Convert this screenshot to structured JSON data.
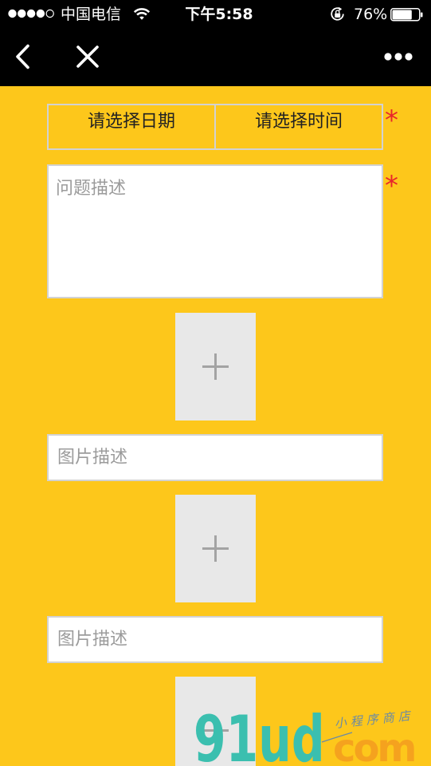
{
  "status_bar": {
    "signal": {
      "icon": "signal-dots-icon",
      "level": 4,
      "max": 5
    },
    "carrier": "中国电信",
    "wifi_icon": "wifi-icon",
    "time": "下午5:58",
    "rotation_lock_icon": "rotation-lock-icon",
    "battery": {
      "icon": "battery-icon",
      "percent_text": "76%",
      "level": 0.76
    }
  },
  "nav_bar": {
    "back_icon": "chevron-left-icon",
    "close_icon": "close-icon",
    "more_icon": "more-dots-icon"
  },
  "form": {
    "date_picker": {
      "label": "请选择日期"
    },
    "time_picker": {
      "label": "请选择时间"
    },
    "required_mark": "*",
    "description": {
      "placeholder": "问题描述"
    },
    "uploads": [
      {
        "add_icon": "plus-icon",
        "caption_placeholder": "图片描述"
      },
      {
        "add_icon": "plus-icon",
        "caption_placeholder": "图片描述"
      },
      {
        "add_icon": "plus-icon"
      }
    ]
  },
  "watermark": {
    "logo_main": "91ud",
    "logo_suffix": "com",
    "tagline": "小程序商店"
  },
  "colors": {
    "bar_background": "#000000",
    "page_background": "#FDC71B",
    "field_border": "#D2D2D2",
    "required": "#E8262B",
    "upload_background": "#E8E8E8",
    "upload_icon": "#A3A3A3",
    "placeholder": "#9B9B9B",
    "watermark_teal": "#3BBFAF",
    "watermark_orange": "#F5A21E",
    "watermark_tagline": "#6A8AA5"
  }
}
